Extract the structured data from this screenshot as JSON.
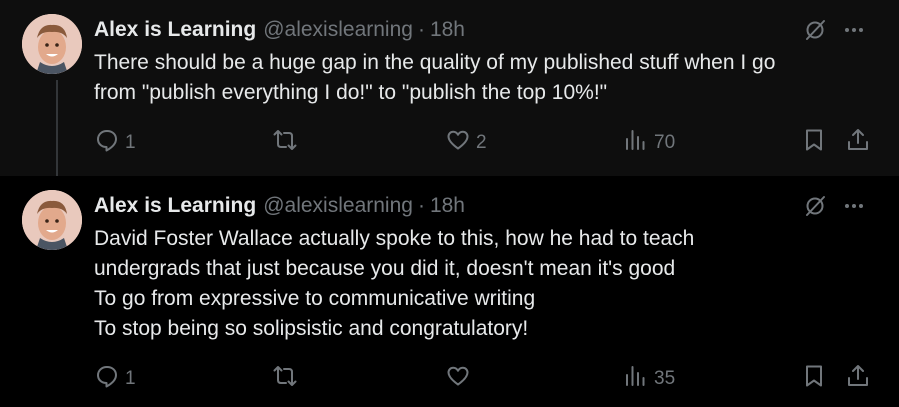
{
  "tweets": [
    {
      "author_name": "Alex is Learning",
      "handle": "@alexislearning",
      "separator": "·",
      "time": "18h",
      "text_lines": [
        "There should be a huge gap in the quality of my published stuff when I go",
        "from \"publish everything I do!\" to \"publish the top 10%!\""
      ],
      "replies": "1",
      "retweets": "",
      "likes": "2",
      "views": "70"
    },
    {
      "author_name": "Alex is Learning",
      "handle": "@alexislearning",
      "separator": "·",
      "time": "18h",
      "text_lines": [
        "David Foster Wallace actually spoke to this, how he had to teach",
        "undergrads that just because you did it, doesn't mean it's good",
        "To go from expressive to communicative writing",
        "To stop being so solipsistic and congratulatory!"
      ],
      "replies": "1",
      "retweets": "",
      "likes": "",
      "views": "35"
    }
  ],
  "icons": {
    "reply": "reply-icon",
    "retweet": "retweet-icon",
    "like": "heart-icon",
    "views": "views-icon",
    "bookmark": "bookmark-icon",
    "share": "share-icon",
    "grok": "grok-icon",
    "more": "more-icon"
  },
  "colors": {
    "background": "#000000",
    "text": "#e7e9ea",
    "secondary": "#71767b"
  }
}
